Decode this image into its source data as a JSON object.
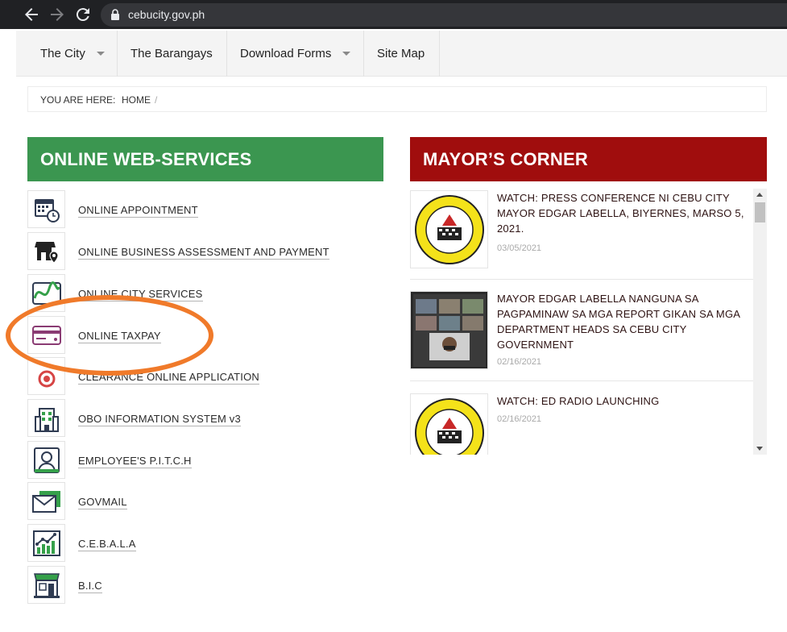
{
  "browser": {
    "url": "cebucity.gov.ph"
  },
  "nav": {
    "items": [
      {
        "label": "The City",
        "has_dropdown": true
      },
      {
        "label": "The Barangays",
        "has_dropdown": false
      },
      {
        "label": "Download Forms",
        "has_dropdown": true
      },
      {
        "label": "Site Map",
        "has_dropdown": false
      }
    ]
  },
  "breadcrumb": {
    "prefix": "YOU ARE HERE:",
    "home": "HOME",
    "separator": "/"
  },
  "services": {
    "title": "ONLINE WEB-SERVICES",
    "color": "#3b9650",
    "items": [
      {
        "label": "ONLINE APPOINTMENT",
        "icon": "calendar-clock-icon"
      },
      {
        "label": "ONLINE BUSINESS ASSESSMENT AND PAYMENT",
        "icon": "store-location-icon"
      },
      {
        "label": "ONLINE CITY SERVICES",
        "icon": "city-services-icon"
      },
      {
        "label": "ONLINE TAXPAY",
        "icon": "credit-card-icon"
      },
      {
        "label": "CLEARANCE ONLINE APPLICATION",
        "icon": "target-icon"
      },
      {
        "label": "OBO INFORMATION SYSTEM v3",
        "icon": "building-icon"
      },
      {
        "label": "EMPLOYEE'S P.I.T.C.H",
        "icon": "employee-icon"
      },
      {
        "label": "GOVMAIL",
        "icon": "mail-icon"
      },
      {
        "label": "C.E.B.A.L.A",
        "icon": "analytics-chart-icon"
      },
      {
        "label": "B.I.C",
        "icon": "shop-icon"
      }
    ]
  },
  "mayor": {
    "title": "MAYOR’S CORNER",
    "color": "#a00d0d",
    "news": [
      {
        "title": "WATCH: PRESS CONFERENCE NI CEBU CITY MAYOR EDGAR LABELLA, BIYERNES, MARSO 5, 2021.",
        "date": "03/05/2021",
        "thumb": "official-seal-icon"
      },
      {
        "title": "MAYOR EDGAR LABELLA NANGUNA SA PAGPAMINAW SA MGA REPORT GIKAN SA MGA DEPARTMENT HEADS SA CEBU CITY GOVERNMENT",
        "date": "02/16/2021",
        "thumb": "video-conference-photo"
      },
      {
        "title": "WATCH: ED RADIO LAUNCHING",
        "date": "02/16/2021",
        "thumb": "official-seal-icon"
      }
    ]
  },
  "annotation": {
    "color": "#f07a2a"
  }
}
